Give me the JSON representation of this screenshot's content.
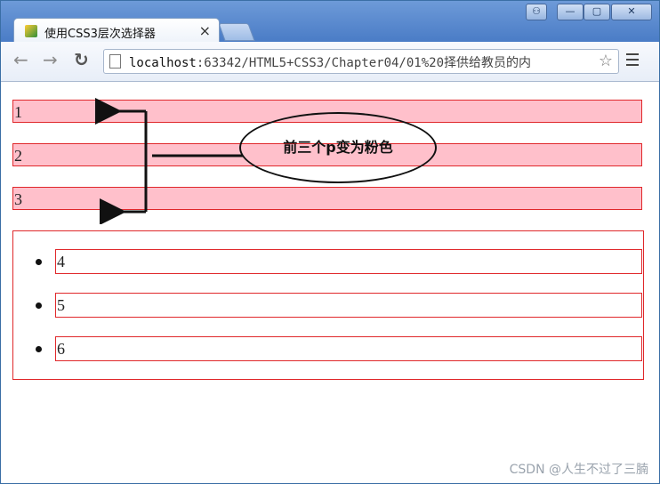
{
  "browser": {
    "tab_title": "使用CSS3层次选择器",
    "tab_close": "×",
    "url_host": "localhost",
    "url_path": ":63342/HTML5+CSS3/Chapter04/01%20择供给教员的内",
    "window_controls": [
      "⚇",
      "—",
      "▢",
      "✕"
    ]
  },
  "page": {
    "paragraphs": [
      "1",
      "2",
      "3"
    ],
    "list_items": [
      "4",
      "5",
      "6"
    ],
    "callout": "前三个p变为粉色"
  },
  "watermark": "CSDN @人生不过了三腩",
  "colors": {
    "pink": "#ffc0cb",
    "border_red": "#e0282b"
  }
}
